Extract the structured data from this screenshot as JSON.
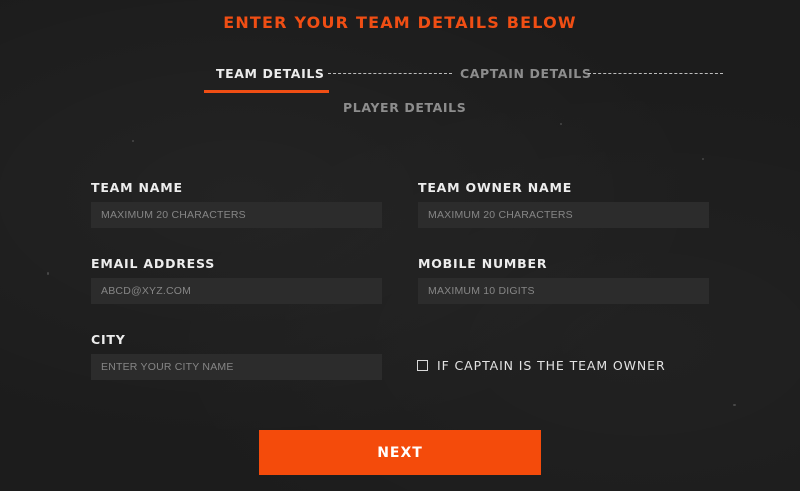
{
  "header": {
    "title": "ENTER YOUR TEAM DETAILS BELOW"
  },
  "steps": {
    "team_details": "TEAM DETAILS",
    "captain_details": "CAPTAIN DETAILS",
    "player_details": "PLAYER DETAILS",
    "active": "TEAM DETAILS"
  },
  "form": {
    "team_name": {
      "label": "TEAM NAME",
      "placeholder": "MAXIMUM 20 CHARACTERS",
      "value": ""
    },
    "team_owner_name": {
      "label": "TEAM OWNER NAME",
      "placeholder": "MAXIMUM 20 CHARACTERS",
      "value": ""
    },
    "email_address": {
      "label": "EMAIL ADDRESS",
      "placeholder": "ABCD@XYZ.COM",
      "value": ""
    },
    "mobile_number": {
      "label": "MOBILE NUMBER",
      "placeholder": "MAXIMUM 10 DIGITS",
      "value": ""
    },
    "city": {
      "label": "CITY",
      "placeholder": "ENTER YOUR CITY NAME",
      "value": ""
    },
    "captain_is_owner": {
      "label": "IF CAPTAIN IS THE TEAM OWNER",
      "checked": false
    }
  },
  "actions": {
    "next_label": "NEXT"
  },
  "colors": {
    "accent": "#f44b0b",
    "background": "#1c1c1c",
    "input_bg": "#2c2c2c"
  }
}
